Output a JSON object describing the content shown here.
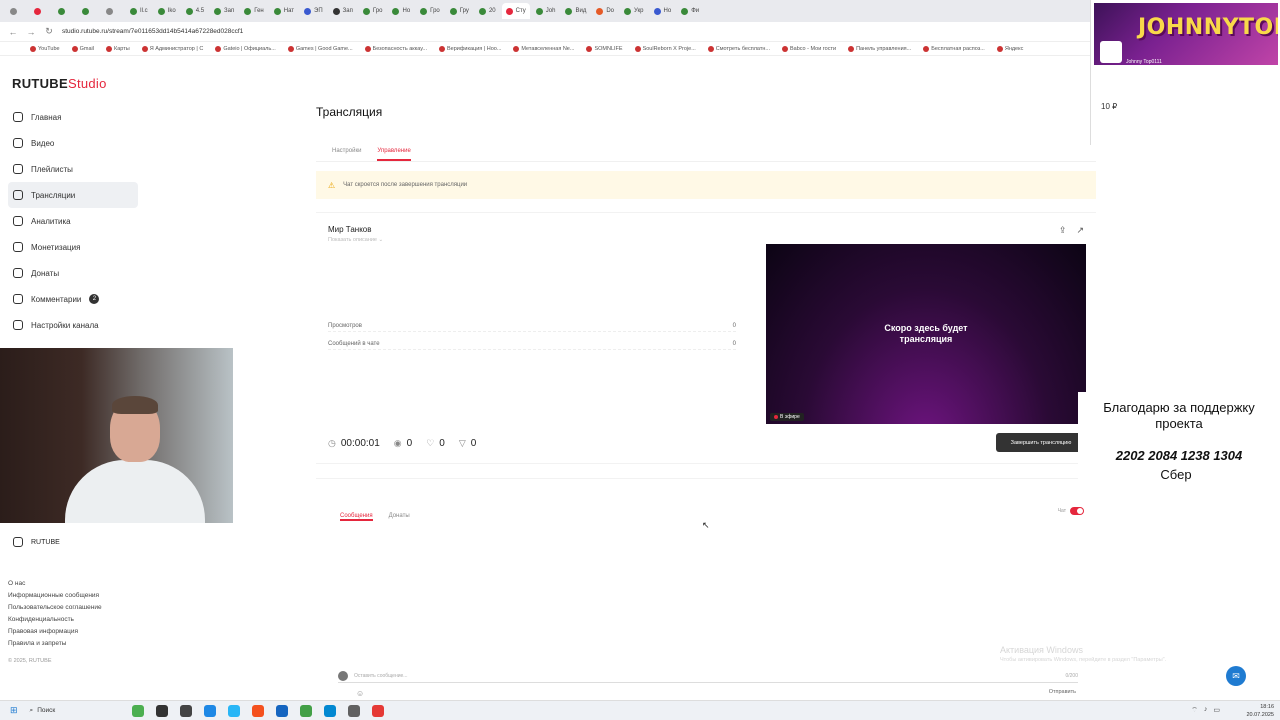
{
  "browser": {
    "tabs": [
      {
        "label": "",
        "color": "#888888"
      },
      {
        "label": "",
        "color": "#e5273d"
      },
      {
        "label": "",
        "color": "#3a8a3a"
      },
      {
        "label": "",
        "color": "#3a8a3a"
      },
      {
        "label": "",
        "color": "#888888"
      },
      {
        "label": "Il.c",
        "color": "#3a8a3a"
      },
      {
        "label": "Iko",
        "color": "#3a8a3a"
      },
      {
        "label": "4.5",
        "color": "#3a8a3a"
      },
      {
        "label": "Зап",
        "color": "#3a8a3a"
      },
      {
        "label": "Ген",
        "color": "#3a8a3a"
      },
      {
        "label": "Нат",
        "color": "#3a8a3a"
      },
      {
        "label": "ЭП",
        "color": "#3a5ad0"
      },
      {
        "label": "Зап",
        "color": "#333333"
      },
      {
        "label": "Гро",
        "color": "#3a8a3a"
      },
      {
        "label": "Но",
        "color": "#3a8a3a"
      },
      {
        "label": "Гро",
        "color": "#3a8a3a"
      },
      {
        "label": "Гру",
        "color": "#3a8a3a"
      },
      {
        "label": "20",
        "color": "#3a8a3a"
      },
      {
        "label": "Сту",
        "color": "#e5273d"
      },
      {
        "label": "Joh",
        "color": "#3a8a3a"
      },
      {
        "label": "Вид",
        "color": "#3a8a3a"
      },
      {
        "label": "Do",
        "color": "#e55a27"
      },
      {
        "label": "Укр",
        "color": "#3a8a3a"
      },
      {
        "label": "Ho",
        "color": "#3a5ad0"
      },
      {
        "label": "Фи",
        "color": "#3a8a3a"
      }
    ],
    "active_tab_index": 18,
    "url": "studio.rutube.ru/stream/7e011653dd14b5414a67228ed028ccf1",
    "bookmarks": [
      "YouTube",
      "Gmail",
      "Карты",
      "Я Администратор | С",
      "Gateio | Официаль...",
      "Games | Good Game...",
      "Безопасность аккау...",
      "Верификация | Hoo...",
      "Метавселенная Ne...",
      "SOMNLIFE",
      "SoulReborn X Proje...",
      "Смотреть бесплатн...",
      "Babco - Мои гости",
      "Панель управления...",
      "Бесплатная распоз...",
      "Яндекс"
    ]
  },
  "studio": {
    "logo_main": "RUTUBE",
    "logo_studio": "Studio",
    "sidebar": [
      {
        "label": "Главная"
      },
      {
        "label": "Видео"
      },
      {
        "label": "Плейлисты"
      },
      {
        "label": "Трансляции"
      },
      {
        "label": "Аналитика"
      },
      {
        "label": "Монетизация"
      },
      {
        "label": "Донаты"
      },
      {
        "label": "Комментарии",
        "badge": "2"
      },
      {
        "label": "Настройки канала"
      }
    ],
    "active_sidebar_index": 3,
    "rutube_link": "RUTUBE",
    "footer_links": [
      "О нас",
      "Информационные сообщения",
      "Пользовательское соглашение",
      "Конфиденциальность",
      "Правовая информация",
      "Правила и запреты"
    ],
    "copyright": "© 2025, RUTUBE"
  },
  "main": {
    "title": "Трансляция",
    "tabs": [
      "Настройки",
      "Управление"
    ],
    "active_tab_index": 1,
    "alert_text": "Чат скроется после завершения трансляции",
    "game_title": "Мир Танков",
    "game_sub": "Показать описание ⌄",
    "stats": [
      {
        "label": "Просмотров",
        "value": "0"
      },
      {
        "label": "Сообщений в чате",
        "value": "0"
      }
    ],
    "preview_text": "Скоро здесь будет трансляция",
    "live_badge": "В эфире",
    "timer": "00:00:01",
    "views": "0",
    "likes": "0",
    "dislikes": "0",
    "end_button": "Завершить трансляцию"
  },
  "chat": {
    "tabs": [
      "Сообщения",
      "Донаты"
    ],
    "active_tab_index": 0,
    "toggle_label": "Чат",
    "input_placeholder": "Оставить сообщение...",
    "counter": "0/200",
    "send_label": "Отправить",
    "accent": "#e5273d"
  },
  "overlay": {
    "banner_title": "JOHNNYTOP",
    "banner_name": "Johnny Top0111",
    "amount": "10 ₽",
    "thanks": "Благодарю за поддержку проекта",
    "card_number": "2202 2084 1238 1304",
    "bank": "Сбер"
  },
  "os": {
    "watermark_title": "Активация Windows",
    "watermark_sub": "Чтобы активировать Windows, перейдите в раздел \"Параметры\".",
    "search_label": "Поиск",
    "time": "18:16",
    "date": "20.07.2025"
  }
}
